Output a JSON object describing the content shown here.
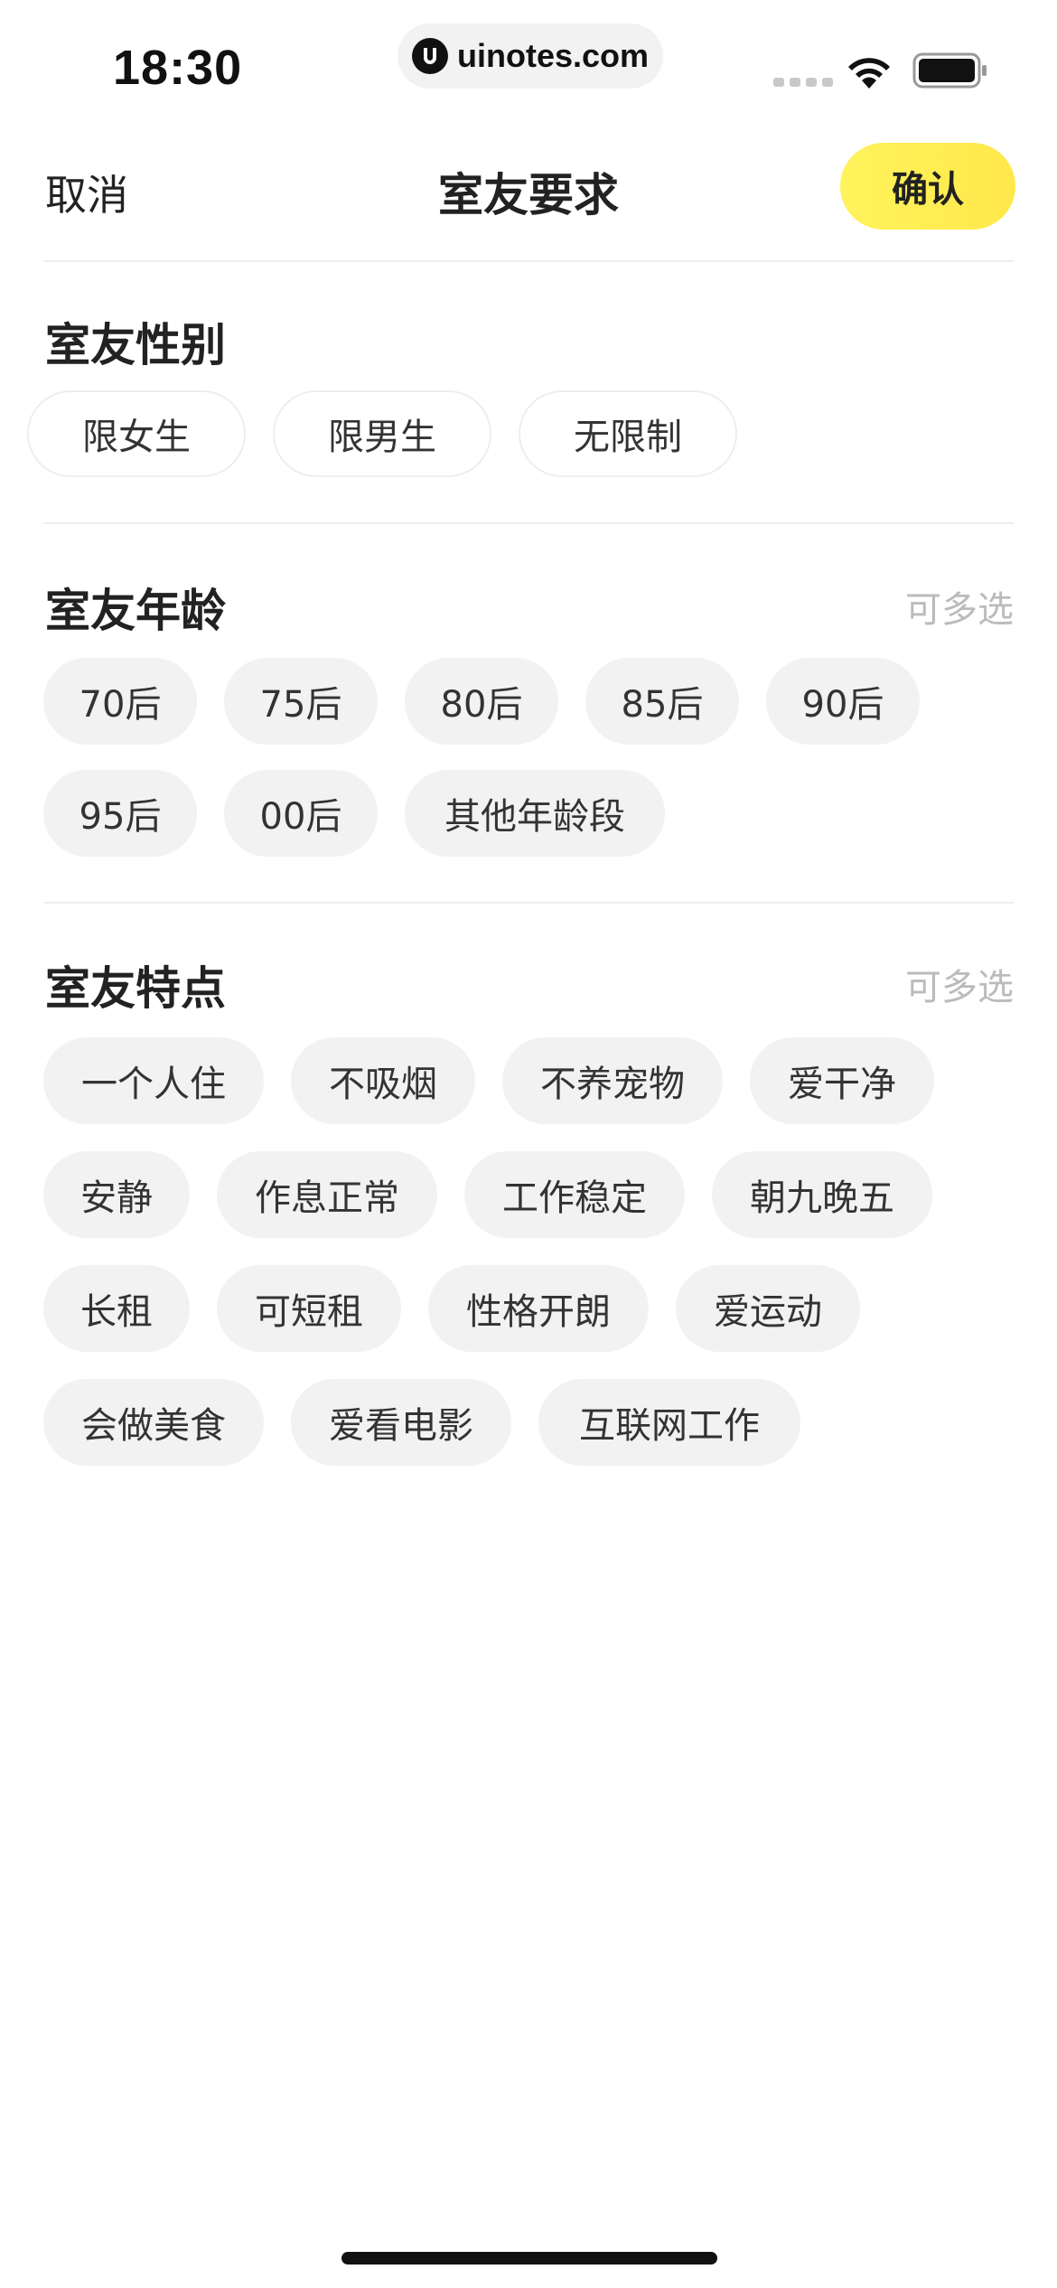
{
  "status_bar": {
    "time": "18:30",
    "url": "uinotes.com",
    "icons": [
      "signal-icon",
      "wifi-icon",
      "battery-icon"
    ]
  },
  "nav": {
    "cancel": "取消",
    "title": "室友要求",
    "confirm": "确认"
  },
  "gender": {
    "title": "室友性别",
    "options": [
      "限女生",
      "限男生",
      "无限制"
    ]
  },
  "age": {
    "title": "室友年龄",
    "hint": "可多选",
    "options": [
      "70后",
      "75后",
      "80后",
      "85后",
      "90后",
      "95后",
      "00后",
      "其他年龄段"
    ]
  },
  "traits": {
    "title": "室友特点",
    "hint": "可多选",
    "options": [
      "一个人住",
      "不吸烟",
      "不养宠物",
      "爱干净",
      "安静",
      "作息正常",
      "工作稳定",
      "朝九晚五",
      "长租",
      "可短租",
      "性格开朗",
      "爱运动",
      "会做美食",
      "爱看电影",
      "互联网工作"
    ]
  },
  "colors": {
    "accent": "#fff35c",
    "chip_bg": "#f2f2f2",
    "hint_text": "#bbbbbb"
  }
}
